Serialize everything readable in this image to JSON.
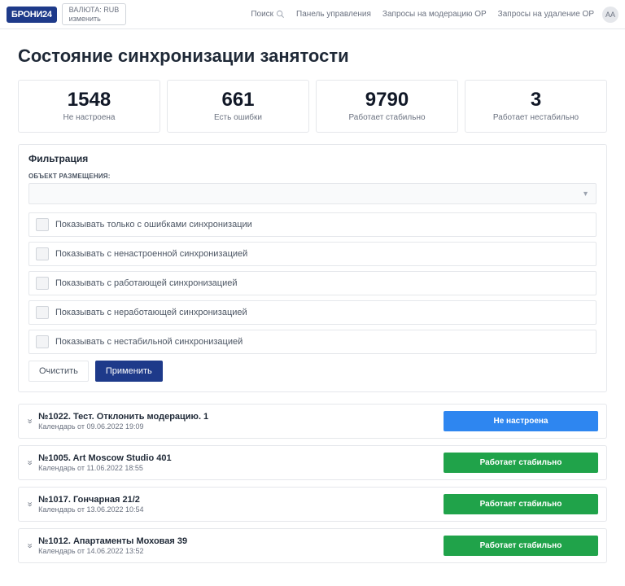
{
  "topbar": {
    "logo": "БРОНИ24",
    "currency_label": "ВАЛЮТА: RUB",
    "currency_change": "изменить",
    "search": "Поиск",
    "links": [
      "Панель управления",
      "Запросы на модерацию ОР",
      "Запросы на удаление ОР"
    ],
    "avatar": "АА"
  },
  "page_title": "Состояние синхронизации занятости",
  "stats": [
    {
      "value": "1548",
      "label": "Не настроена"
    },
    {
      "value": "661",
      "label": "Есть ошибки"
    },
    {
      "value": "9790",
      "label": "Работает стабильно"
    },
    {
      "value": "3",
      "label": "Работает нестабильно"
    }
  ],
  "filter": {
    "title": "Фильтрация",
    "object_label": "ОБЪЕКТ РАЗМЕЩЕНИЯ:",
    "checks": [
      "Показывать только с ошибками синхронизации",
      "Показывать с ненастроенной синхронизацией",
      "Показывать с работающей синхронизацией",
      "Показывать с неработающей синхронизацией",
      "Показывать с нестабильной синхронизацией"
    ],
    "clear": "Очистить",
    "apply": "Применить"
  },
  "results": [
    {
      "title": "№1022. Тест. Отклонить модерацию. 1",
      "sub": "Календарь от 09.06.2022 19:09",
      "status": "Не настроена",
      "color": "blue"
    },
    {
      "title": "№1005. Art Moscow Studio 401",
      "sub": "Календарь от 11.06.2022 18:55",
      "status": "Работает стабильно",
      "color": "green"
    },
    {
      "title": "№1017. Гончарная 21/2",
      "sub": "Календарь от 13.06.2022 10:54",
      "status": "Работает стабильно",
      "color": "green"
    },
    {
      "title": "№1012. Апартаменты Моховая 39",
      "sub": "Календарь от 14.06.2022 13:52",
      "status": "Работает стабильно",
      "color": "green"
    }
  ]
}
